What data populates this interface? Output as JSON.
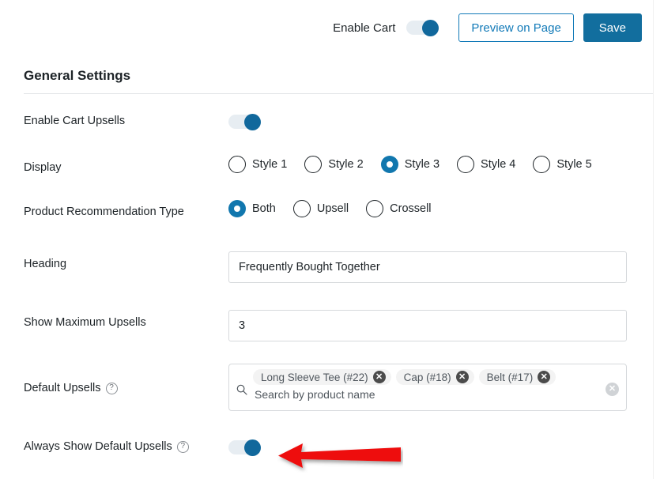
{
  "topbar": {
    "enable_cart_label": "Enable Cart",
    "enable_cart_toggle": "on",
    "preview_button": "Preview on Page",
    "save_button": "Save"
  },
  "section": {
    "title": "General Settings"
  },
  "rows": {
    "enable_cart_upsells": {
      "label": "Enable Cart Upsells",
      "toggle": "on"
    },
    "display": {
      "label": "Display",
      "options": [
        {
          "label": "Style 1",
          "checked": false
        },
        {
          "label": "Style 2",
          "checked": false
        },
        {
          "label": "Style 3",
          "checked": true
        },
        {
          "label": "Style 4",
          "checked": false
        },
        {
          "label": "Style 5",
          "checked": false
        }
      ]
    },
    "recommendation_type": {
      "label": "Product Recommendation Type",
      "options": [
        {
          "label": "Both",
          "checked": true
        },
        {
          "label": "Upsell",
          "checked": false
        },
        {
          "label": "Crossell",
          "checked": false
        }
      ]
    },
    "heading": {
      "label": "Heading",
      "value": "Frequently Bought Together",
      "placeholder": ""
    },
    "max_upsells": {
      "label": "Show Maximum Upsells",
      "value": "3",
      "placeholder": ""
    },
    "default_upsells": {
      "label": "Default Upsells",
      "help": "?",
      "placeholder": "Search by product name",
      "search_icon": "search-icon",
      "clear_all_icon": "clear-all-icon",
      "tags": [
        {
          "label": "Long Sleeve Tee (#22)",
          "remove_icon": "close-icon"
        },
        {
          "label": "Cap (#18)",
          "remove_icon": "close-icon"
        },
        {
          "label": "Belt (#17)",
          "remove_icon": "close-icon"
        }
      ]
    },
    "always_show_default_upsells": {
      "label": "Always Show Default Upsells",
      "help": "?",
      "toggle": "on"
    }
  },
  "annotation": {
    "arrow": "red-left-arrow",
    "color": "#ee1111"
  },
  "colors": {
    "accent_blue": "#11689c",
    "link_blue": "#127ab8",
    "save_blue": "#126e9e",
    "text": "#1d2327",
    "muted": "#50575e",
    "border": "#d6d9dc",
    "toggle_track": "#e7edf2",
    "tag_bg": "#f3f3f3",
    "arrow_red": "#ee1111"
  }
}
